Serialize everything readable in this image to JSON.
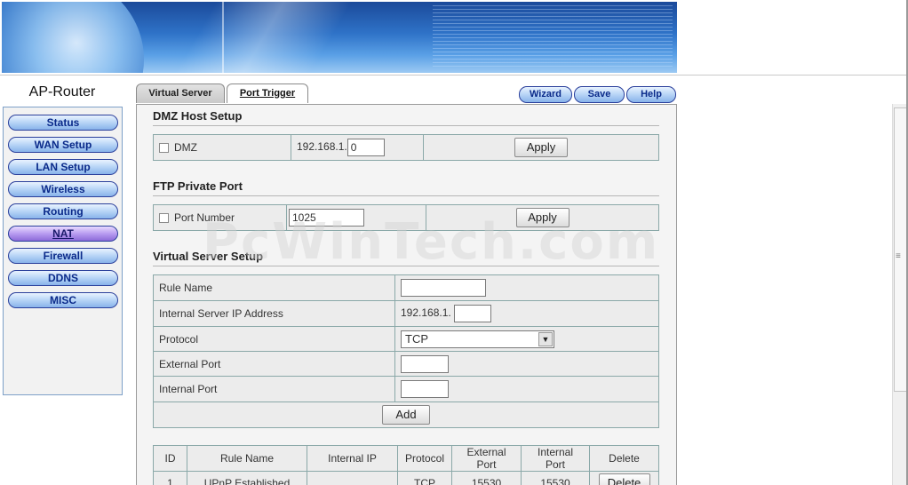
{
  "brand": "AP-Router",
  "nav": {
    "items": [
      "Status",
      "WAN Setup",
      "LAN Setup",
      "Wireless",
      "Routing",
      "NAT",
      "Firewall",
      "DDNS",
      "MISC"
    ],
    "active": "NAT"
  },
  "tabs": {
    "virtual_server": "Virtual Server",
    "port_trigger": "Port Trigger"
  },
  "toolbar": {
    "wizard": "Wizard",
    "save": "Save",
    "help": "Help"
  },
  "dmz": {
    "title": "DMZ Host Setup",
    "checkbox_label": "DMZ",
    "ip_prefix": "192.168.1.",
    "ip_value": "0",
    "apply": "Apply"
  },
  "ftp": {
    "title": "FTP Private Port",
    "checkbox_label": "Port Number",
    "port_value": "1025",
    "apply": "Apply"
  },
  "vs": {
    "title": "Virtual Server Setup",
    "rule_name_label": "Rule Name",
    "rule_name_value": "",
    "ip_label": "Internal Server IP Address",
    "ip_prefix": "192.168.1.",
    "ip_value": "",
    "protocol_label": "Protocol",
    "protocol_value": "TCP",
    "ext_port_label": "External Port",
    "ext_port_value": "",
    "int_port_label": "Internal Port",
    "int_port_value": "",
    "add": "Add"
  },
  "table": {
    "headers": [
      "ID",
      "Rule Name",
      "Internal IP",
      "Protocol",
      "External Port",
      "Internal Port",
      "Delete"
    ],
    "rows": [
      {
        "id": "1",
        "rule_name": "UPnP Established",
        "internal_ip": "",
        "protocol": "TCP",
        "external_port": "15530",
        "internal_port": "15530",
        "delete": "Delete"
      }
    ]
  },
  "watermark": "PcWinTech.com",
  "scroll_grip": "≡",
  "icons": {
    "dropdown": "chevron-down-icon"
  }
}
